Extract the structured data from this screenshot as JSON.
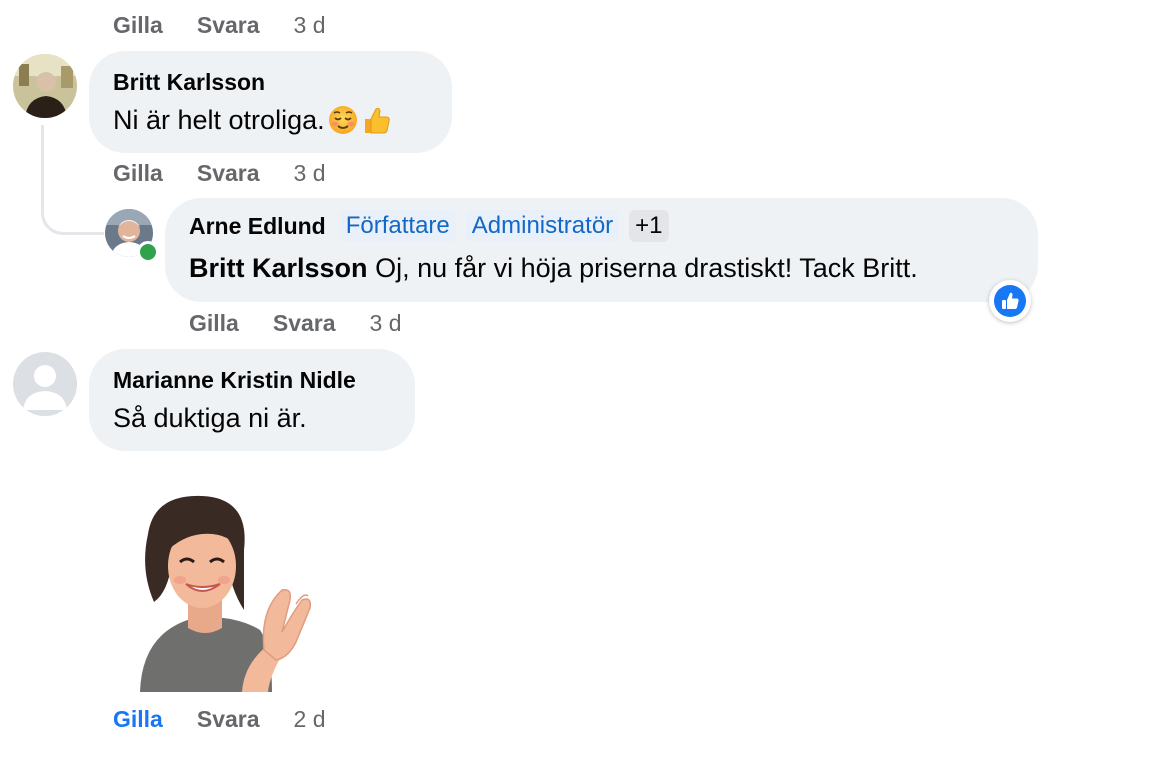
{
  "comments": [
    {
      "actions": {
        "like": "Gilla",
        "reply": "Svara",
        "time": "3 d"
      }
    },
    {
      "author": "Britt Karlsson",
      "text": "Ni är helt otroliga.",
      "emojis": [
        "relieved-face-emoji",
        "thumbs-up-emoji"
      ],
      "actions": {
        "like": "Gilla",
        "reply": "Svara",
        "time": "3 d"
      }
    },
    {
      "author": "Arne Edlund",
      "badges": [
        "Författare",
        "Administratör",
        "+1"
      ],
      "mention": "Britt Karlsson",
      "text": "Oj, nu får vi höja priserna drastiskt! Tack Britt.",
      "reaction": "like-reaction-icon",
      "online": true,
      "actions": {
        "like": "Gilla",
        "reply": "Svara",
        "time": "3 d"
      }
    },
    {
      "author": "Marianne Kristin Nidle",
      "text": "Så duktiga ni är.",
      "sticker": "avatar-clapping-sticker",
      "actions": {
        "like": "Gilla",
        "reply": "Svara",
        "time": "2 d",
        "liked": true
      }
    }
  ],
  "colors": {
    "bubble": "#eff2f5",
    "meta": "#65676b",
    "accent": "#1877f2",
    "badge_text": "#1267c7",
    "online": "#31a24c"
  }
}
